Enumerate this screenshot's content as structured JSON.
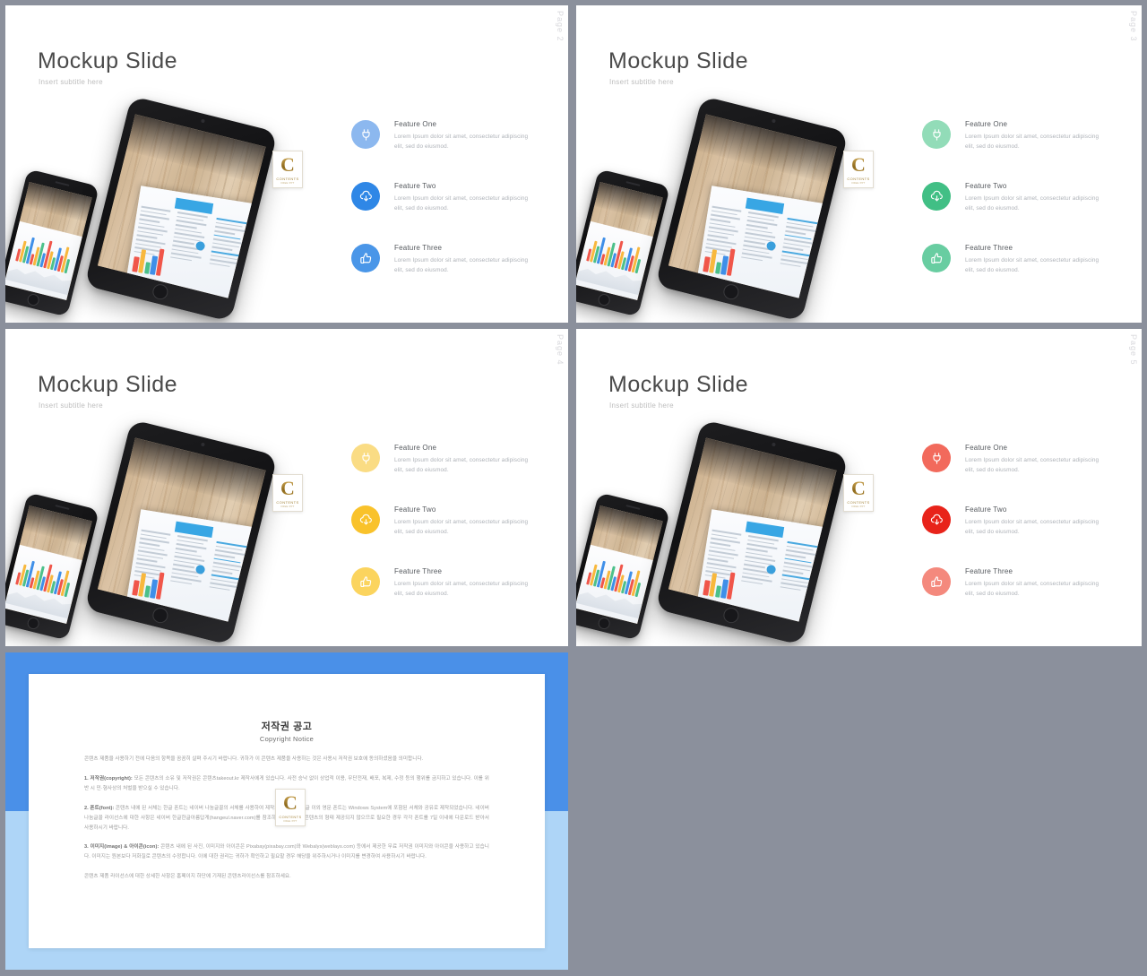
{
  "app": {
    "background_color": "#8b909c",
    "layout": "slide-thumbnail-grid"
  },
  "logo": {
    "letter": "C",
    "word": "CONTENTS",
    "sub": "FREE  PPT"
  },
  "slides": [
    {
      "id": "slide-page-2",
      "title": "Mockup Slide",
      "subtitle": "Insert subtitle here",
      "page_label": "Page 2",
      "accent": "#3f8fe8",
      "icon_colors": [
        "#8cb8ef",
        "#2f87e6",
        "#4a96e8"
      ],
      "features": [
        {
          "title": "Feature One",
          "icon": "plug-icon",
          "desc": "Lorem Ipsum dolor sit amet, consectetur adipiscing elit, sed do eiusmod."
        },
        {
          "title": "Feature Two",
          "icon": "cloud-download-icon",
          "desc": "Lorem Ipsum dolor sit amet, consectetur adipiscing elit, sed do eiusmod."
        },
        {
          "title": "Feature Three",
          "icon": "thumbs-up-icon",
          "desc": "Lorem Ipsum dolor sit amet, consectetur adipiscing elit, sed do eiusmod."
        }
      ]
    },
    {
      "id": "slide-page-3",
      "title": "Mockup Slide",
      "subtitle": "Insert subtitle here",
      "page_label": "Page 3",
      "accent": "#4cc08a",
      "icon_colors": [
        "#92dcb8",
        "#41bf85",
        "#68cda1"
      ],
      "features": [
        {
          "title": "Feature One",
          "icon": "plug-icon",
          "desc": "Lorem Ipsum dolor sit amet, consectetur adipiscing elit, sed do eiusmod."
        },
        {
          "title": "Feature Two",
          "icon": "cloud-download-icon",
          "desc": "Lorem Ipsum dolor sit amet, consectetur adipiscing elit, sed do eiusmod."
        },
        {
          "title": "Feature Three",
          "icon": "thumbs-up-icon",
          "desc": "Lorem Ipsum dolor sit amet, consectetur adipiscing elit, sed do eiusmod."
        }
      ]
    },
    {
      "id": "slide-page-4",
      "title": "Mockup Slide",
      "subtitle": "Insert subtitle here",
      "page_label": "Page 4",
      "accent": "#f5c543",
      "icon_colors": [
        "#fadc84",
        "#f9c22b",
        "#fbd45e"
      ],
      "features": [
        {
          "title": "Feature One",
          "icon": "plug-icon",
          "desc": "Lorem Ipsum dolor sit amet, consectetur adipiscing elit, sed do eiusmod."
        },
        {
          "title": "Feature Two",
          "icon": "cloud-download-icon",
          "desc": "Lorem Ipsum dolor sit amet, consectetur adipiscing elit, sed do eiusmod."
        },
        {
          "title": "Feature Three",
          "icon": "thumbs-up-icon",
          "desc": "Lorem Ipsum dolor sit amet, consectetur adipiscing elit, sed do eiusmod."
        }
      ]
    },
    {
      "id": "slide-page-5",
      "title": "Mockup Slide",
      "subtitle": "Insert subtitle here",
      "page_label": "Page 5",
      "accent": "#ef4136",
      "icon_colors": [
        "#f26a5c",
        "#e8231a",
        "#f4897d"
      ],
      "features": [
        {
          "title": "Feature One",
          "icon": "plug-icon",
          "desc": "Lorem Ipsum dolor sit amet, consectetur adipiscing elit, sed do eiusmod."
        },
        {
          "title": "Feature Two",
          "icon": "cloud-download-icon",
          "desc": "Lorem Ipsum dolor sit amet, consectetur adipiscing elit, sed do eiusmod."
        },
        {
          "title": "Feature Three",
          "icon": "thumbs-up-icon",
          "desc": "Lorem Ipsum dolor sit amet, consectetur adipiscing elit, sed do eiusmod."
        }
      ]
    }
  ],
  "copyright_slide": {
    "frame_color_top": "#4a90e8",
    "frame_color_bottom": "#aed5f7",
    "title": "저작권 공고",
    "subtitle": "Copyright Notice",
    "paragraphs": [
      "콘텐츠 제품을 사용하기 전에 다음의 항목을 꼼꼼히 살펴 주시기 바랍니다. 귀하가 이 콘텐츠 제품을 사용하는 것은 사용시 저작권 보호에 동의하셨음을 의미합니다.",
      "1. 저작권(copyright): 모든 콘텐츠의 소유 및 저작권은 콘텐츠takeout.kr 제작사에게 있습니다. 사전 승낙 없이 상업적 이용, 무단전재, 배포, 복제, 수정 등의 행위를 금지하고 있습니다. 이를 위반 시 민·형사상의 처벌을 받으실 수 있습니다.",
      "2. 폰트(font): 콘텐츠 내에 된 서체는 한글 폰트는 네이버 나눔글꼴의 서체를 사용하여 제작되었습니다. 한글 이외 영문 폰트는 Windows System에 포함된 서체와 공유로 제작되었습니다. 네이버 나눔글꼴 라이선스에 대한 사항은 네이버 한글한글아름답게(hangeul.naver.com)를 참조하세요. 폰트는 콘텐츠의 형태 제공되지 않으므로 필요한 경우 각각 폰트를 7일 이내에 다운로드 받아서 사용하시기 바랍니다.",
      "3. 이미지(image) & 아이콘(icon): 콘텐츠 내에 된 사진, 이미지와 아이콘은 Pixabay(pixabay.com)와 Webalys(weblays.com) 등에서 제공한 무료 저작권 이미지와 아이콘을 사용하고 있습니다. 이미지는 원본보다 저화질로 콘텐츠의 수정합니다. 이에 대한 권리는 귀하가 확인하고 필요할 경우 해당을 위주하시거나 이미지를 변경하여 사용하시기 바랍니다.",
      "콘텐츠 제품 라이선스에 대한 상세한 사항은 홈페이지 하단에 기재된 콘텐츠라이선스를 참조하세요."
    ]
  }
}
